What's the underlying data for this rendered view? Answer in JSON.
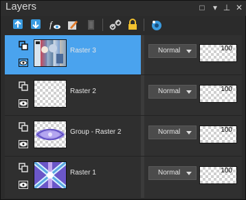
{
  "window": {
    "title": "Layers"
  },
  "titlebar_buttons": [
    {
      "name": "restore-icon",
      "glyph": "□"
    },
    {
      "name": "dropdown-icon",
      "glyph": "▾"
    },
    {
      "name": "pin-icon",
      "glyph": "⊥"
    },
    {
      "name": "close-icon",
      "glyph": "✕"
    }
  ],
  "toolbar": {
    "tools": [
      "new-raster-layer-icon",
      "merge-down-icon",
      "new-adjustment-layer-icon",
      "edit-layer-icon",
      "delete-layer-icon",
      "link-icon",
      "lock-icon",
      "view-icon"
    ]
  },
  "layers": [
    {
      "name": "Raster 3",
      "blend_mode": "Normal",
      "opacity": "100",
      "selected": true,
      "thumbnail": "collage"
    },
    {
      "name": "Raster 2",
      "blend_mode": "Normal",
      "opacity": "100",
      "selected": false,
      "thumbnail": "transparent"
    },
    {
      "name": "Group - Raster 2",
      "blend_mode": "Normal",
      "opacity": "100",
      "selected": false,
      "thumbnail": "purple-pattern"
    },
    {
      "name": "Raster 1",
      "blend_mode": "Normal",
      "opacity": "100",
      "selected": false,
      "thumbnail": "purple-x"
    }
  ],
  "colors": {
    "selection": "#4aa3ee",
    "panel": "#2b2b2b",
    "accent_blue": "#3a9be0",
    "lock_yellow": "#f2c12e"
  }
}
